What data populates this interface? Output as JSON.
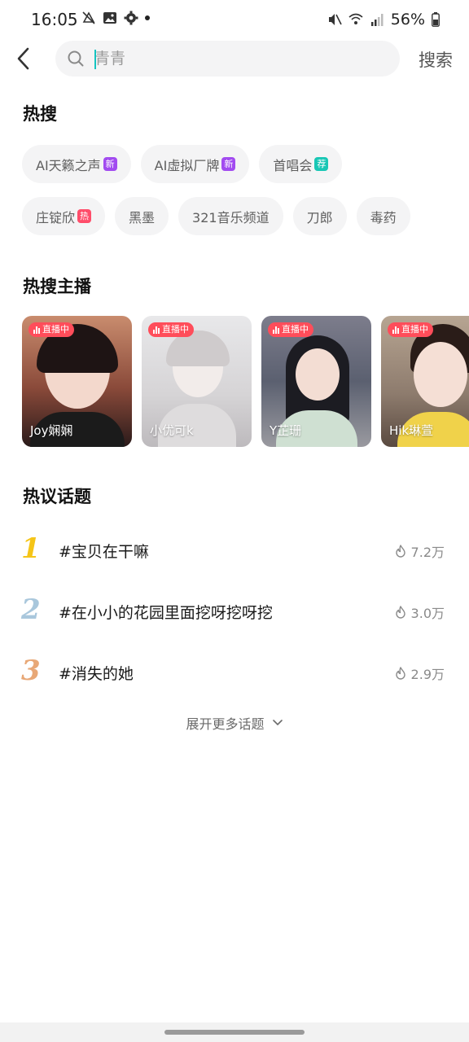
{
  "status_bar": {
    "time": "16:05",
    "battery": "56%"
  },
  "search": {
    "placeholder": "青青",
    "submit_label": "搜索"
  },
  "hot_search": {
    "title": "热搜",
    "rows": [
      [
        {
          "label": "AI天籁之声",
          "badge": "新",
          "badge_color": "#a24bf0"
        },
        {
          "label": "AI虚拟厂牌",
          "badge": "新",
          "badge_color": "#a24bf0"
        },
        {
          "label": "首唱会",
          "badge": "荐",
          "badge_color": "#19c7b5"
        }
      ],
      [
        {
          "label": "庄锭欣",
          "badge": "热",
          "badge_color": "#ff4d6a"
        },
        {
          "label": "黑墨",
          "badge": ""
        },
        {
          "label": "321音乐频道",
          "badge": ""
        },
        {
          "label": "刀郎",
          "badge": ""
        },
        {
          "label": "毒药",
          "badge": ""
        }
      ]
    ]
  },
  "hot_streamers": {
    "title": "热搜主播",
    "live_label": "直播中",
    "items": [
      {
        "name": "Joy娴娴"
      },
      {
        "name": "小优可k"
      },
      {
        "name": "Y芷珊"
      },
      {
        "name": "Hik琳萱"
      }
    ]
  },
  "hot_topics": {
    "title": "热议话题",
    "items": [
      {
        "rank": "1",
        "text": "#宝贝在干嘛",
        "heat": "7.2万",
        "color": "#f5c518"
      },
      {
        "rank": "2",
        "text": "#在小小的花园里面挖呀挖呀挖",
        "heat": "3.0万",
        "color": "#a9c7dc"
      },
      {
        "rank": "3",
        "text": "#消失的她",
        "heat": "2.9万",
        "color": "#e8a877"
      }
    ],
    "expand_label": "展开更多话题"
  }
}
